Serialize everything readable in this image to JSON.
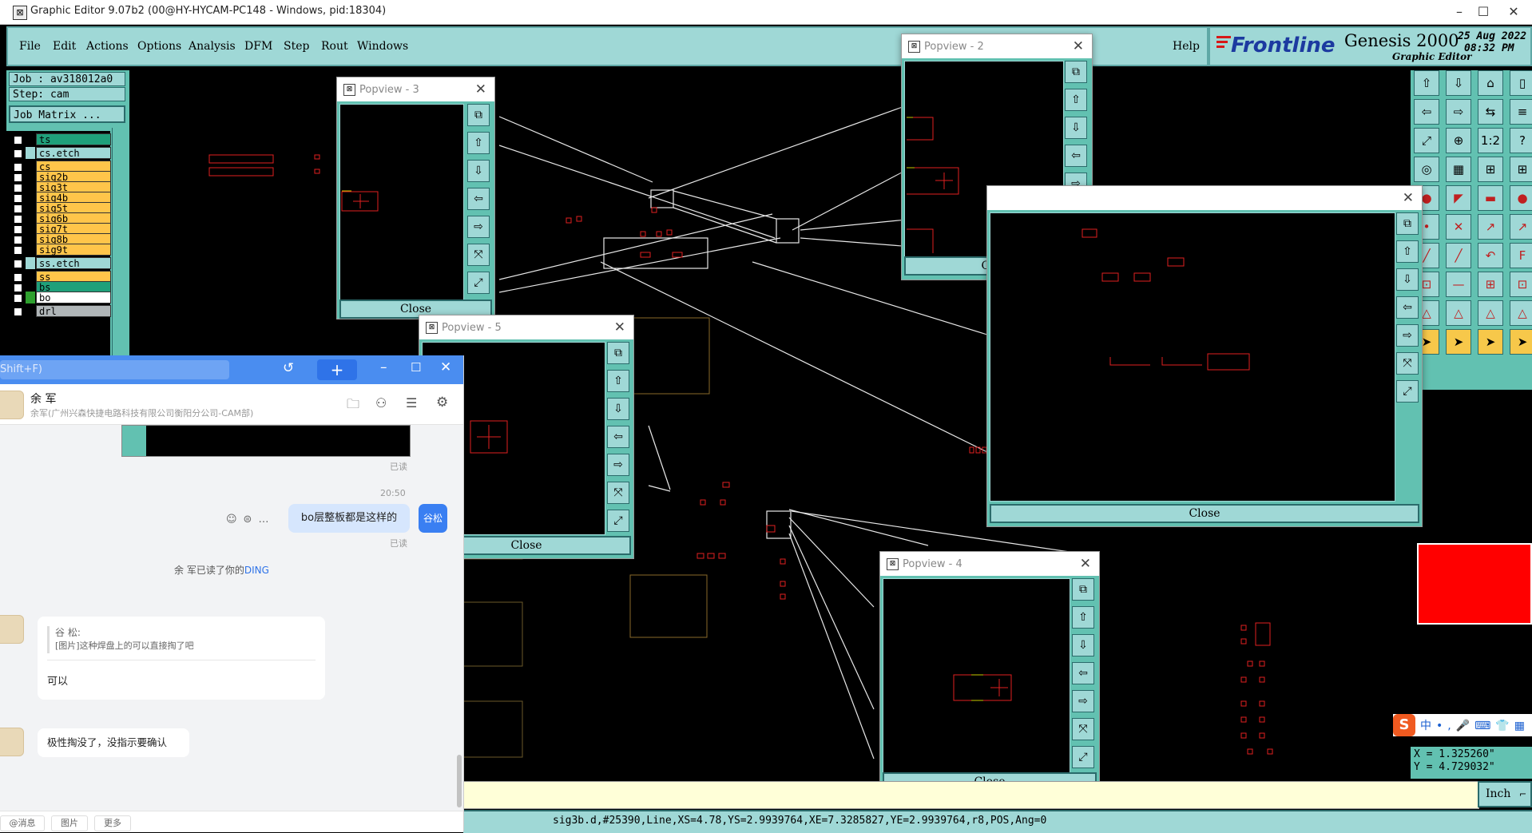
{
  "app": {
    "title": "Graphic Editor 9.07b2 (00@HY-HYCAM-PC148 - Windows, pid:18304)",
    "menu": [
      "File",
      "Edit",
      "Actions",
      "Options",
      "Analysis",
      "DFM",
      "Step",
      "Rout",
      "Windows"
    ],
    "help_label": "Help",
    "brand": "Frontline",
    "product": "Genesis 2000",
    "subtitle": "Graphic Editor",
    "date": "25 Aug 2022",
    "time": "08:32 PM"
  },
  "left_panel": {
    "job_label": "Job : av318012a0",
    "step_label": "Step: cam",
    "job_matrix_label": "Job Matrix ...",
    "layers": [
      {
        "name": "ts",
        "color": "#1fa07a",
        "swatch": "#000000"
      },
      {
        "name": "cs.etch",
        "color": "#9fd8d6",
        "swatch": "#9fd8d6"
      },
      {
        "name": "cs",
        "color": "#ffc54a",
        "swatch": "#000000"
      },
      {
        "name": "sig2b",
        "color": "#ffc54a",
        "swatch": "#000000"
      },
      {
        "name": "sig3t",
        "color": "#ffc54a",
        "swatch": "#000000"
      },
      {
        "name": "sig4b",
        "color": "#ffc54a",
        "swatch": "#000000"
      },
      {
        "name": "sig5t",
        "color": "#ffc54a",
        "swatch": "#000000"
      },
      {
        "name": "sig6b",
        "color": "#ffc54a",
        "swatch": "#000000"
      },
      {
        "name": "sig7t",
        "color": "#ffc54a",
        "swatch": "#000000"
      },
      {
        "name": "sig8b",
        "color": "#ffc54a",
        "swatch": "#000000"
      },
      {
        "name": "sig9t",
        "color": "#ffc54a",
        "swatch": "#000000"
      },
      {
        "name": "ss.etch",
        "color": "#9fd8d6",
        "swatch": "#9fd8d6"
      },
      {
        "name": "ss",
        "color": "#ffc54a",
        "swatch": "#000000"
      },
      {
        "name": "bs",
        "color": "#1fa07a",
        "swatch": "#000000"
      },
      {
        "name": "bo",
        "color": "#ffffff",
        "swatch": "#2ea02e"
      },
      {
        "name": "drl",
        "color": "#b0b6b8",
        "swatch": "#000000"
      }
    ]
  },
  "popviews": {
    "p2": {
      "title": "Popview - 2",
      "close": "Close"
    },
    "p3": {
      "title": "Popview - 3",
      "close": "Close"
    },
    "p4": {
      "title": "Popview - 4",
      "close": "Close"
    },
    "p5": {
      "title": "Popview - 5",
      "close": "Close"
    },
    "big": {
      "title": "",
      "close": "Close"
    }
  },
  "right_tools": {
    "label_1to2": "1:2",
    "label_q": "?"
  },
  "coords": {
    "x": "X = 1.325260\"",
    "y": "Y = 4.729032\""
  },
  "unit_label": "Inch",
  "status": "sig3b.d,#25390,Line,XS=4.78,YS=2.9939764,XE=7.3285827,YE=2.9939764,r8,POS,Ang=0",
  "chat": {
    "search_placeholder": "Shift+F)",
    "contact_name": "余 军",
    "contact_org": "余军(广州兴森快捷电路科技有限公司衡阳分公司-CAM部)",
    "read_1": "已读",
    "time_1": "20:50",
    "msg_bo": "bo层整板都是这样的",
    "self_name": "谷松",
    "read_2": "已读",
    "ding_prefix": "余 军已读了你的",
    "ding_link": "DING",
    "quote_name": "谷 松:",
    "quote_text": "[图片]这种焊盘上的可以直接掏了吧",
    "reply_1": "可以",
    "reply_2": "极性掏没了，没指示要确认",
    "bottom_tabs": [
      "@消息",
      "图片",
      "更多"
    ]
  }
}
